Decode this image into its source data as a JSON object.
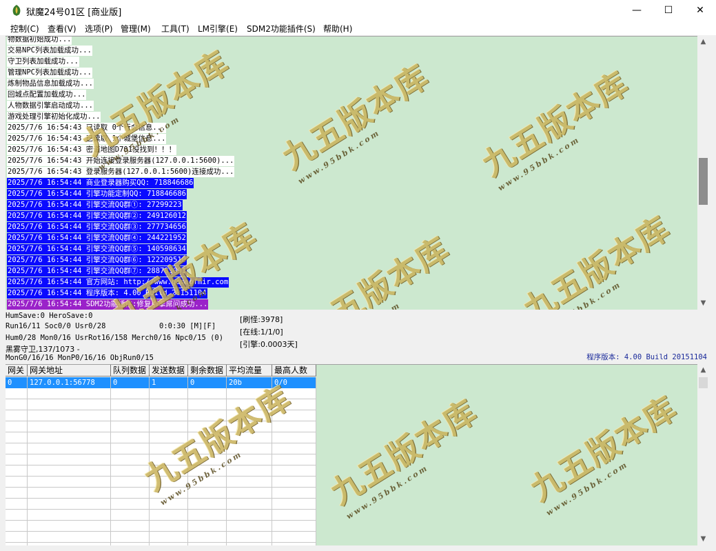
{
  "window": {
    "title": "狱魔24号01区 [商业版]",
    "buttons": {
      "minimize": "—",
      "maximize": "☐",
      "close": "✕"
    }
  },
  "menu": [
    "控制(C)",
    "查看(V)",
    "选项(P)",
    "管理(M)",
    "工具(T)",
    "LM引擎(E)",
    "SDM2功能插件(S)",
    "帮助(H)"
  ],
  "log": [
    {
      "text": "物数据初始成功...",
      "style": "plain"
    },
    {
      "text": "交易NPC列表加载成功...",
      "style": "plain"
    },
    {
      "text": "守卫列表加载成功...",
      "style": "plain"
    },
    {
      "text": "管理NPC列表加载成功...",
      "style": "plain"
    },
    {
      "text": "炼制物品信息加载成功...",
      "style": "plain"
    },
    {
      "text": "回城点配置加载成功...",
      "style": "plain"
    },
    {
      "text": "人物数据引擎启动成功...",
      "style": "plain"
    },
    {
      "text": "游戏处理引擎初始化成功...",
      "style": "plain"
    },
    {
      "text": "2025/7/6 16:54:43 已读取 0个行会信息...",
      "style": "plain"
    },
    {
      "text": "2025/7/6 16:54:43 已读取 1个城堡信息...",
      "style": "plain"
    },
    {
      "text": "2025/7/6 16:54:43 密道地图D701没找到！！！",
      "style": "plain"
    },
    {
      "text": "2025/7/6 16:54:43 开始连接登录服务器(127.0.0.1:5600)...",
      "style": "plain"
    },
    {
      "text": "2025/7/6 16:54:43 登录服务器(127.0.0.1:5600)连接成功...",
      "style": "plain"
    },
    {
      "text": "2025/7/6 16:54:44 商业登录器购买QQ: 718846686",
      "style": "sel"
    },
    {
      "text": "2025/7/6 16:54:44 引擎功能定制QQ: 718846686",
      "style": "sel"
    },
    {
      "text": "2025/7/6 16:54:44 引擎交流QQ群①: 27299223",
      "style": "sel"
    },
    {
      "text": "2025/7/6 16:54:44 引擎交流QQ群②: 249126012",
      "style": "sel"
    },
    {
      "text": "2025/7/6 16:54:44 引擎交流QQ群③: 277734656",
      "style": "sel"
    },
    {
      "text": "2025/7/6 16:54:44 引擎交流QQ群④: 244221952",
      "style": "sel"
    },
    {
      "text": "2025/7/6 16:54:44 引擎交流QQ群⑤: 140598634",
      "style": "sel"
    },
    {
      "text": "2025/7/6 16:54:44 引擎交流QQ群⑥: 122209510",
      "style": "sel"
    },
    {
      "text": "2025/7/6 16:54:44 引擎交流QQ群⑦: 288703001",
      "style": "sel"
    },
    {
      "text": "2025/7/6 16:54:44 官方网站: http://www.gameofmir.com",
      "style": "sel"
    },
    {
      "text": "2025/7/6 16:54:44 程序版本: 4.00 Build 20151104",
      "style": "sel"
    },
    {
      "text": "2025/7/6 16:54:44 SDM2功能插件:修复引擎屌问成功...",
      "style": "sel-purple"
    }
  ],
  "status": {
    "save": "HumSave:0 HeroSave:0",
    "run": "Run16/11 Soc0/0 Usr0/28",
    "timer": "0:0:30 [M][F]",
    "hum": "Hum0/28 Mon0/16 UsrRot16/158 Merch0/16 Npc0/15 (0)",
    "map": "黑雾守卫,137/1073 -",
    "mon": "MonG0/16/16 MonP0/16/16 ObjRun0/15",
    "refresh_monsters": "[刷怪:3978]",
    "online": "[在线:1/1/0]",
    "engine": "[引擎:0.0003天]",
    "version": "程序版本: 4.00 Build 20151104"
  },
  "grid": {
    "headers": [
      "网关",
      "网关地址",
      "队列数据",
      "发送数据",
      "剩余数据",
      "平均流量",
      "最高人数"
    ],
    "rows": [
      [
        "0",
        "127.0.0.1:56778",
        "0",
        "1",
        "0",
        "20b",
        "0/0"
      ]
    ]
  },
  "watermark": {
    "main": "九五版本库",
    "sub": "www.95bbk.com"
  }
}
